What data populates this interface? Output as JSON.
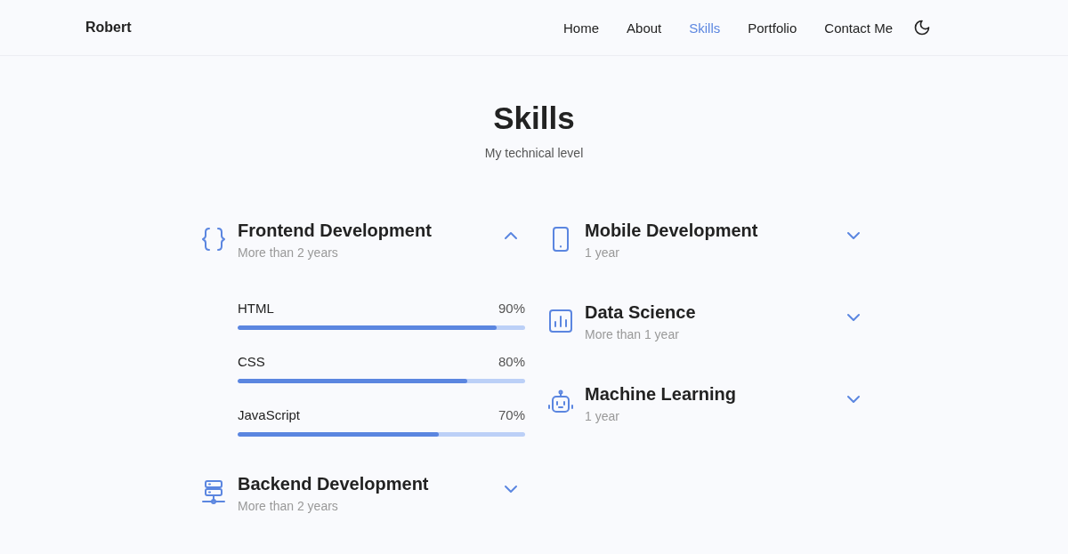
{
  "header": {
    "logo": "Robert",
    "nav": [
      {
        "label": "Home",
        "selected": false
      },
      {
        "label": "About",
        "selected": false
      },
      {
        "label": "Skills",
        "selected": true
      },
      {
        "label": "Portfolio",
        "selected": false
      },
      {
        "label": "Contact Me",
        "selected": false
      }
    ]
  },
  "section": {
    "title": "Skills",
    "subtitle": "My technical level"
  },
  "columns": [
    {
      "categories": [
        {
          "kind": "code",
          "title": "Frontend Development",
          "subtitle": "More than 2 years",
          "expanded": true,
          "skills": [
            {
              "name": "HTML",
              "reading": "90%",
              "level": 0.9
            },
            {
              "name": "CSS",
              "reading": "80%",
              "level": 0.8
            },
            {
              "name": "JavaScript",
              "reading": "70%",
              "level": 0.7
            }
          ]
        },
        {
          "kind": "server",
          "title": "Backend Development",
          "subtitle": "More than 2 years",
          "expanded": false
        }
      ]
    },
    {
      "categories": [
        {
          "kind": "phone",
          "title": "Mobile Development",
          "subtitle": "1 year",
          "expanded": false
        },
        {
          "kind": "chart",
          "title": "Data Science",
          "subtitle": "More than 1 year",
          "expanded": false
        },
        {
          "kind": "robot",
          "title": "Machine Learning",
          "subtitle": "1 year",
          "expanded": false
        }
      ]
    }
  ]
}
